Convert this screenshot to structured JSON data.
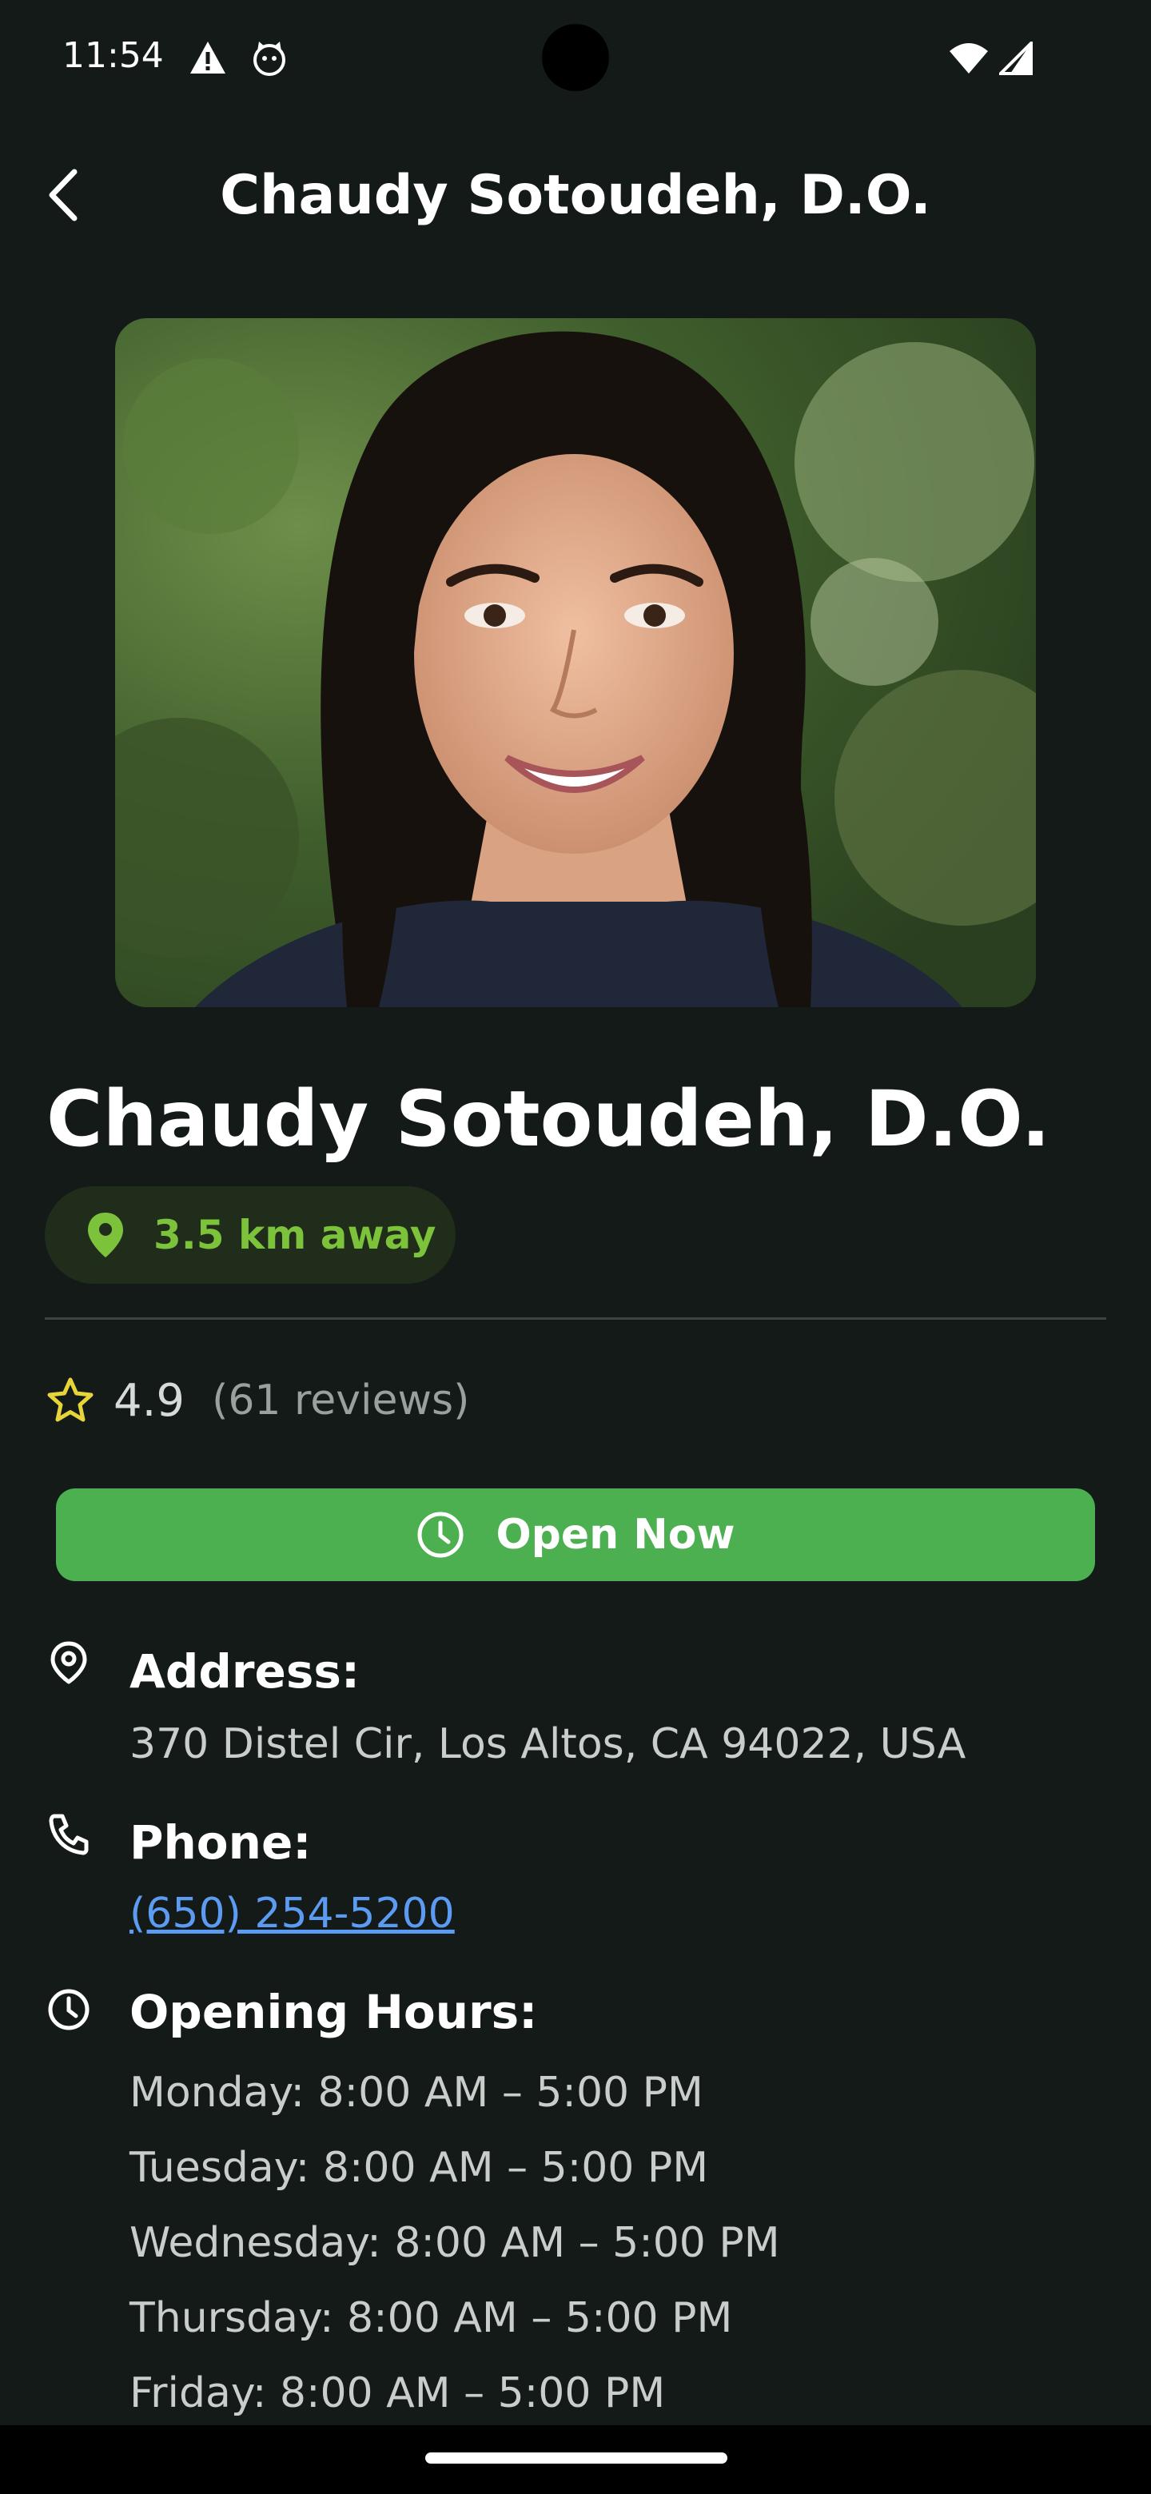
{
  "status_bar": {
    "time": "11:54",
    "icons": [
      "warning-icon",
      "cat-face-icon",
      "wifi-icon",
      "signal-icon"
    ]
  },
  "header": {
    "title": "Chaudy Sotoudeh, D.O.",
    "back_icon": "chevron-left-icon"
  },
  "profile": {
    "name": "Chaudy Sotoudeh, D.O.",
    "distance": "3.5 km away",
    "rating": "4.9",
    "reviews": "(61 reviews)",
    "open_status": "Open Now"
  },
  "details": {
    "address_label": "Address:",
    "address_value": "370 Distel Cir, Los Altos, CA 94022, USA",
    "phone_label": "Phone:",
    "phone_value": "(650) 254-5200",
    "hours_label": "Opening Hours:",
    "hours": [
      "Monday: 8:00 AM – 5:00 PM",
      "Tuesday: 8:00 AM – 5:00 PM",
      "Wednesday: 8:00 AM – 5:00 PM",
      "Thursday: 8:00 AM – 5:00 PM",
      "Friday: 8:00 AM – 5:00 PM"
    ]
  },
  "colors": {
    "background": "#141a18",
    "accent_green": "#4caf50",
    "distance_green": "#7cc23b",
    "link_blue": "#5b9cf2",
    "star_yellow": "#e6d43a"
  }
}
